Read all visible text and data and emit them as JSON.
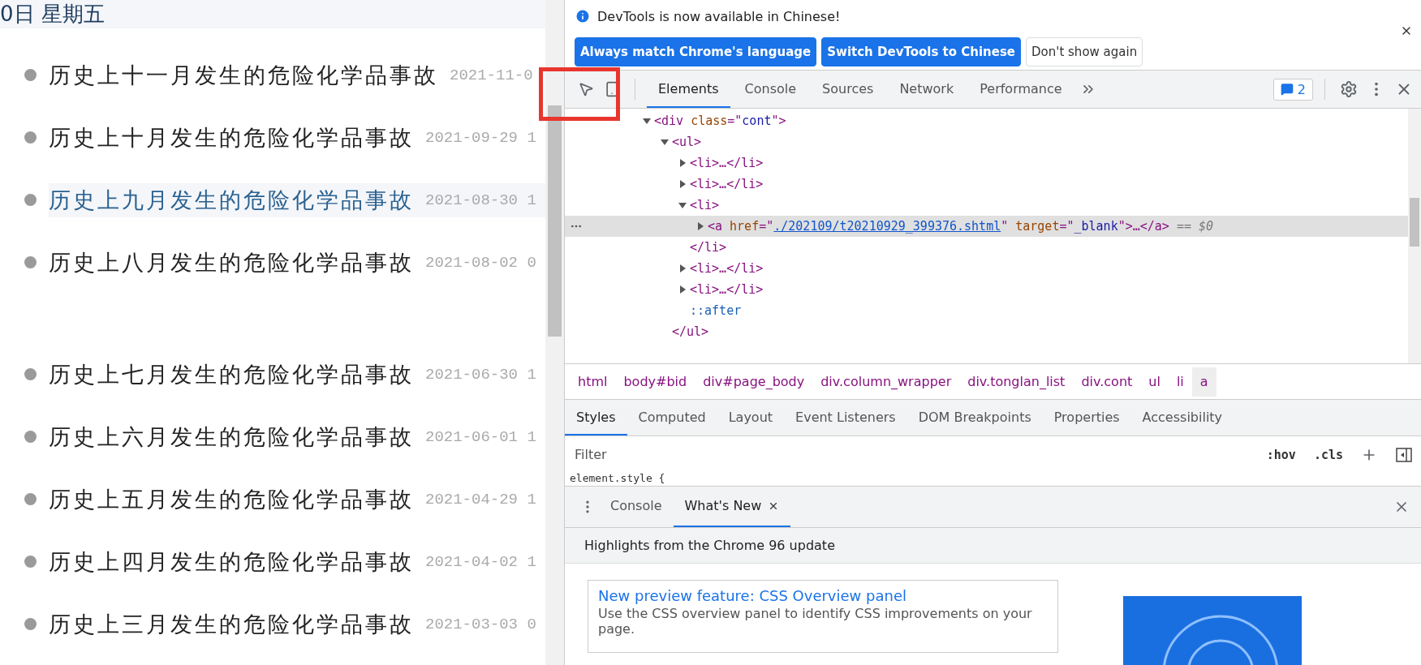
{
  "page": {
    "header": "0日 星期五",
    "groups": [
      {
        "items": [
          {
            "title": "历史上十一月发生的危险化学品事故",
            "date": "2021-11-0",
            "hovered": false
          },
          {
            "title": "历史上十月发生的危险化学品事故",
            "date": "2021-09-29 1",
            "hovered": false
          },
          {
            "title": "历史上九月发生的危险化学品事故",
            "date": "2021-08-30 1",
            "hovered": true
          },
          {
            "title": "历史上八月发生的危险化学品事故",
            "date": "2021-08-02 0",
            "hovered": false
          }
        ]
      },
      {
        "items": [
          {
            "title": "历史上七月发生的危险化学品事故",
            "date": "2021-06-30 1",
            "hovered": false
          },
          {
            "title": "历史上六月发生的危险化学品事故",
            "date": "2021-06-01 1",
            "hovered": false
          },
          {
            "title": "历史上五月发生的危险化学品事故",
            "date": "2021-04-29 1",
            "hovered": false
          },
          {
            "title": "历史上四月发生的危险化学品事故",
            "date": "2021-04-02 1",
            "hovered": false
          },
          {
            "title": "历史上三月发生的危险化学品事故",
            "date": "2021-03-03 0",
            "hovered": false
          }
        ]
      }
    ]
  },
  "devtools": {
    "notice": {
      "message": "DevTools is now available in Chinese!",
      "buttons": [
        {
          "label": "Always match Chrome's language",
          "kind": "primary"
        },
        {
          "label": "Switch DevTools to Chinese",
          "kind": "primary"
        },
        {
          "label": "Don't show again",
          "kind": "secondary"
        }
      ]
    },
    "tabs": [
      {
        "label": "Elements",
        "selected": true
      },
      {
        "label": "Console",
        "selected": false
      },
      {
        "label": "Sources",
        "selected": false
      },
      {
        "label": "Network",
        "selected": false
      },
      {
        "label": "Performance",
        "selected": false
      }
    ],
    "issues_count": "2",
    "tree": [
      {
        "kind": "expandable",
        "expanded": true,
        "selected": false,
        "tokens": [
          {
            "kind": "tag",
            "text": "<div"
          },
          {
            "kind": "attr",
            "text": "class"
          },
          {
            "kind": "punct",
            "text": "=\""
          },
          {
            "kind": "value",
            "text": "cont"
          },
          {
            "kind": "punct",
            "text": "\">"
          }
        ],
        "children": [
          {
            "kind": "expandable",
            "expanded": true,
            "selected": false,
            "tokens": [
              {
                "kind": "tag",
                "text": "<ul>"
              }
            ],
            "children": [
              {
                "kind": "expandable",
                "expanded": false,
                "selected": false,
                "tokens": [
                  {
                    "kind": "tag",
                    "text": "<li>…</li>"
                  }
                ]
              },
              {
                "kind": "expandable",
                "expanded": false,
                "selected": false,
                "tokens": [
                  {
                    "kind": "tag",
                    "text": "<li>…</li>"
                  }
                ]
              },
              {
                "kind": "expandable",
                "expanded": true,
                "selected": false,
                "tokens": [
                  {
                    "kind": "tag",
                    "text": "<li>"
                  }
                ],
                "children": [
                  {
                    "kind": "expandable",
                    "expanded": false,
                    "selected": true,
                    "tokens": [
                      {
                        "kind": "tag",
                        "text": "<a"
                      },
                      {
                        "kind": "attr",
                        "text": "href"
                      },
                      {
                        "kind": "punct",
                        "text": "=\""
                      },
                      {
                        "kind": "link",
                        "text": "./202109/t20210929_399376.shtml"
                      },
                      {
                        "kind": "punct",
                        "text": "\""
                      },
                      {
                        "kind": "attr",
                        "text": "target"
                      },
                      {
                        "kind": "punct",
                        "text": "=\""
                      },
                      {
                        "kind": "value",
                        "text": "_blank"
                      },
                      {
                        "kind": "punct",
                        "text": "\">…</a>"
                      },
                      {
                        "kind": "note",
                        "text": "== $0"
                      }
                    ]
                  }
                ],
                "close": [
                  {
                    "kind": "tag",
                    "text": "</li>"
                  }
                ]
              },
              {
                "kind": "expandable",
                "expanded": false,
                "selected": false,
                "tokens": [
                  {
                    "kind": "tag",
                    "text": "<li>…</li>"
                  }
                ]
              },
              {
                "kind": "expandable",
                "expanded": false,
                "selected": false,
                "tokens": [
                  {
                    "kind": "tag",
                    "text": "<li>…</li>"
                  }
                ]
              },
              {
                "kind": "plain",
                "selected": false,
                "tokens": [
                  {
                    "kind": "pseudo",
                    "text": "::after"
                  }
                ]
              }
            ],
            "close": [
              {
                "kind": "tag",
                "text": "</ul>"
              }
            ]
          }
        ]
      }
    ],
    "breadcrumbs": [
      {
        "label": "html",
        "selected": false
      },
      {
        "label": "body#bid",
        "selected": false
      },
      {
        "label": "div#page_body",
        "selected": false
      },
      {
        "label": "div.column_wrapper",
        "selected": false
      },
      {
        "label": "div.tonglan_list",
        "selected": false
      },
      {
        "label": "div.cont",
        "selected": false
      },
      {
        "label": "ul",
        "selected": false
      },
      {
        "label": "li",
        "selected": false
      },
      {
        "label": "a",
        "selected": true
      }
    ],
    "style_tabs": [
      {
        "label": "Styles",
        "selected": true
      },
      {
        "label": "Computed",
        "selected": false
      },
      {
        "label": "Layout",
        "selected": false
      },
      {
        "label": "Event Listeners",
        "selected": false
      },
      {
        "label": "DOM Breakpoints",
        "selected": false
      },
      {
        "label": "Properties",
        "selected": false
      },
      {
        "label": "Accessibility",
        "selected": false
      }
    ],
    "filter": {
      "placeholder": "Filter",
      "hov": ":hov",
      "cls": ".cls"
    },
    "style_rule": "element.style {",
    "drawer": {
      "tabs": [
        {
          "label": "Console",
          "selected": false,
          "closable": false
        },
        {
          "label": "What's New",
          "selected": true,
          "closable": true
        }
      ],
      "heading": "Highlights from the Chrome 96 update",
      "card": {
        "title": "New preview feature: CSS Overview panel",
        "description": "Use the CSS overview panel to identify CSS improvements on your page."
      }
    }
  }
}
